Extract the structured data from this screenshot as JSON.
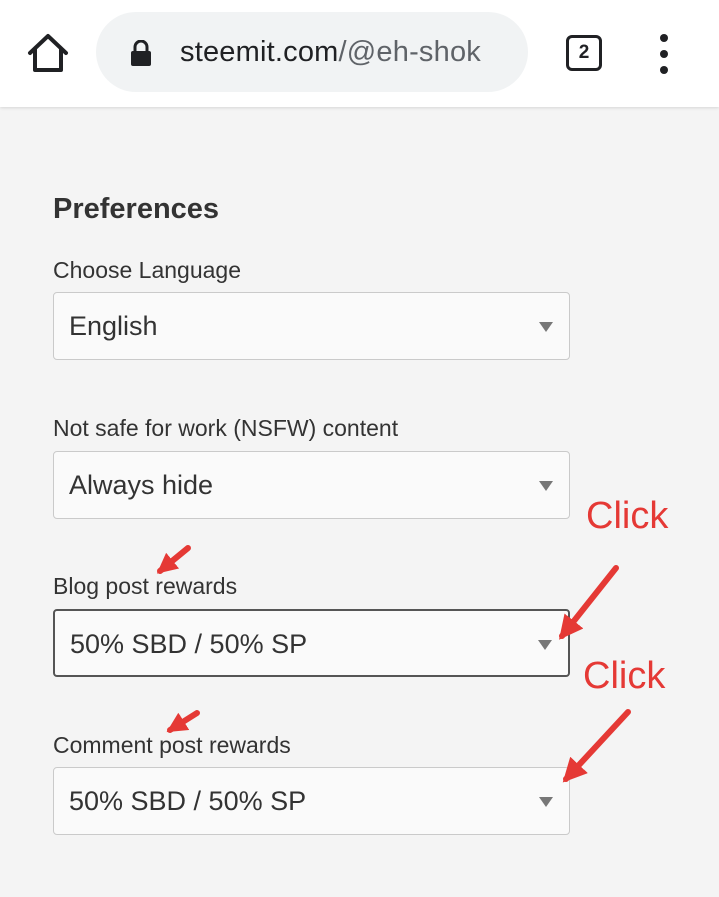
{
  "browser": {
    "url_host": "steemit.com",
    "url_path": "/@eh-shok",
    "tab_count": "2"
  },
  "preferences": {
    "title": "Preferences",
    "language": {
      "label": "Choose Language",
      "value": "English"
    },
    "nsfw": {
      "label": "Not safe for work (NSFW) content",
      "value": "Always hide"
    },
    "blog_rewards": {
      "label": "Blog post rewards",
      "value": "50% SBD / 50% SP"
    },
    "comment_rewards": {
      "label": "Comment post rewards",
      "value": "50% SBD / 50% SP"
    }
  },
  "annotations": {
    "click_1": "Click",
    "click_2": "Click",
    "arrow_color": "#e53935"
  },
  "colors": {
    "page_background": "#f4f4f4",
    "text": "#333333",
    "select_background": "#fafafa"
  }
}
